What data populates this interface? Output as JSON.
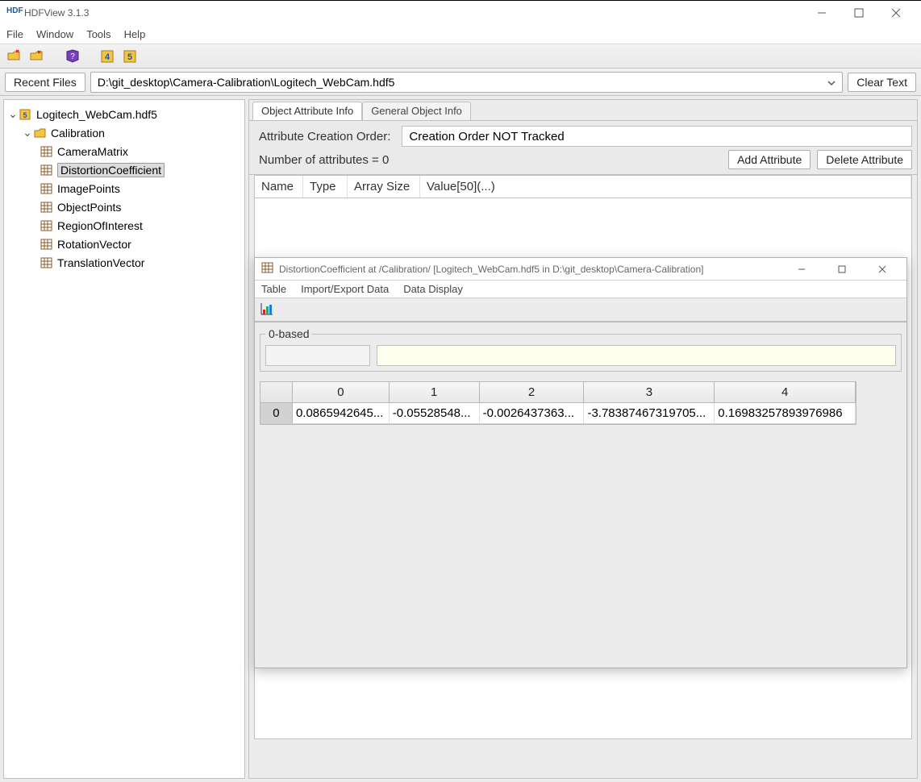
{
  "window": {
    "title": "HDFView 3.1.3"
  },
  "menubar": {
    "items": [
      "File",
      "Window",
      "Tools",
      "Help"
    ]
  },
  "toolbar": {
    "icons": [
      {
        "name": "open-file-icon"
      },
      {
        "name": "close-file-icon"
      },
      {
        "name": "help-icon"
      },
      {
        "name": "hdf4-icon",
        "badge": "4"
      },
      {
        "name": "hdf5-icon",
        "badge": "5"
      }
    ]
  },
  "recent": {
    "label": "Recent Files",
    "path": "D:\\git_desktop\\Camera-Calibration\\Logitech_WebCam.hdf5",
    "clear": "Clear Text"
  },
  "tree": {
    "root": {
      "label": "Logitech_WebCam.hdf5",
      "expanded": true
    },
    "group": {
      "label": "Calibration",
      "expanded": true
    },
    "datasets": [
      "CameraMatrix",
      "DistortionCoefficient",
      "ImagePoints",
      "ObjectPoints",
      "RegionOfInterest",
      "RotationVector",
      "TranslationVector"
    ],
    "selected_index": 1
  },
  "tabs": {
    "items": [
      "Object Attribute Info",
      "General Object Info"
    ],
    "active_index": 0
  },
  "attr_panel": {
    "order_label": "Attribute Creation Order:",
    "order_value": "Creation Order NOT Tracked",
    "num_attr_label": "Number of attributes = 0",
    "add_btn": "Add Attribute",
    "del_btn": "Delete Attribute",
    "headers": [
      "Name",
      "Type",
      "Array Size",
      "Value[50](...)"
    ]
  },
  "child": {
    "title": "DistortionCoefficient  at  /Calibration/  [Logitech_WebCam.hdf5  in  D:\\git_desktop\\Camera-Calibration]",
    "menu": [
      "Table",
      "Import/Export Data",
      "Data Display"
    ],
    "zero_based_label": "0-based",
    "table": {
      "col_headers": [
        "0",
        "1",
        "2",
        "3",
        "4"
      ],
      "row_headers": [
        "0"
      ],
      "cells": [
        [
          "0.0865942645...",
          "-0.05528548...",
          "-0.0026437363...",
          "-3.78387467319705...",
          "0.16983257893976986"
        ]
      ]
    }
  }
}
